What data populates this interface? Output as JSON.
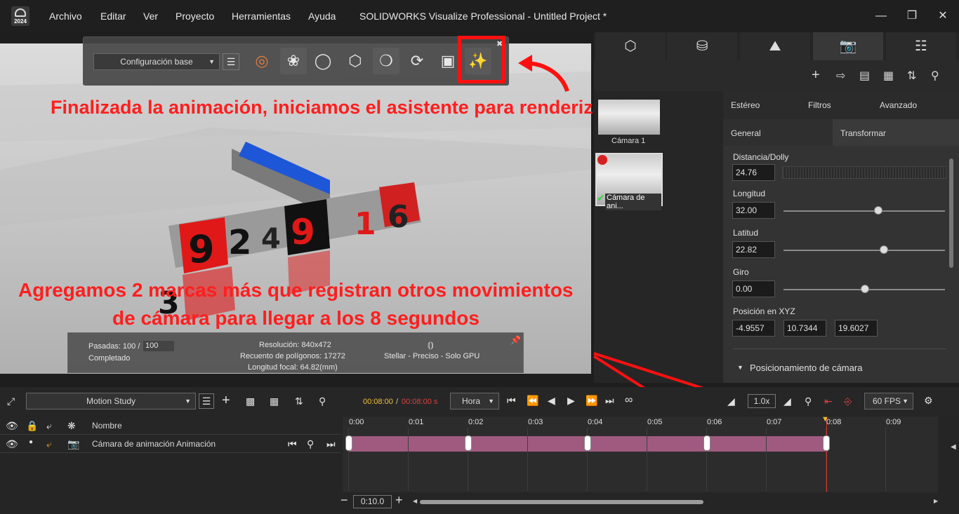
{
  "app": {
    "menu": [
      "Archivo",
      "Editar",
      "Ver",
      "Proyecto",
      "Herramientas",
      "Ayuda"
    ],
    "window_title": "SOLIDWORKS Visualize Professional - Untitled Project *",
    "logo_year": "2024"
  },
  "toolbar": {
    "config": "Configuración base"
  },
  "annotations": {
    "top": "Finalizada la animación, iniciamos el asistente para renderizar",
    "bottom_line1": "Agregamos 2 marcas más que registran otros movimientos",
    "bottom_line2": "de cámara para llegar a los 8 segundos"
  },
  "stats": {
    "passes_label": "Pasadas: 100 /",
    "passes_input": "100",
    "status": "Completado",
    "resolution": "Resolución: 840x472",
    "polygons": "Recuento de polígonos: 17272",
    "focal": "Longitud focal: 64.82(mm)",
    "mode": "Stellar - Preciso - Solo GPU"
  },
  "cameras": [
    {
      "label": "Cámara 1"
    },
    {
      "label": "Cámara de ani..."
    }
  ],
  "camera_tabs": {
    "row1": [
      "Estéreo",
      "Filtros",
      "Avanzado"
    ],
    "row2": [
      "General",
      "Transformar"
    ]
  },
  "transform": {
    "dolly_label": "Distancia/Dolly",
    "dolly_value": "24.76",
    "longitude_label": "Longitud",
    "longitude_value": "32.00",
    "latitude_label": "Latitud",
    "latitude_value": "22.82",
    "roll_label": "Giro",
    "roll_value": "0.00",
    "xyz_label": "Posición en XYZ",
    "x": "-4.9557",
    "y": "10.7344",
    "z": "19.6027",
    "section": "Posicionamiento de cámara"
  },
  "timeline": {
    "study": "Motion Study",
    "time_current": "00:08:00",
    "time_separator": " / ",
    "time_total": "00:08:00 s",
    "unit": "Hora",
    "speed": "1.0x",
    "fps": "60 FPS",
    "name_header": "Nombre",
    "track_name": "Cámara de animación Animación",
    "zoom_value": "0:10.0",
    "ticks": [
      "0:00",
      "0:01",
      "0:02",
      "0:03",
      "0:04",
      "0:05",
      "0:06",
      "0:07",
      "0:08",
      "0:09"
    ],
    "keyframes_sec": [
      0,
      2,
      4,
      6,
      8
    ]
  },
  "colors": {
    "annotation": "#ff1e1e",
    "track": "#a05a80",
    "playhead": "#e03030"
  }
}
